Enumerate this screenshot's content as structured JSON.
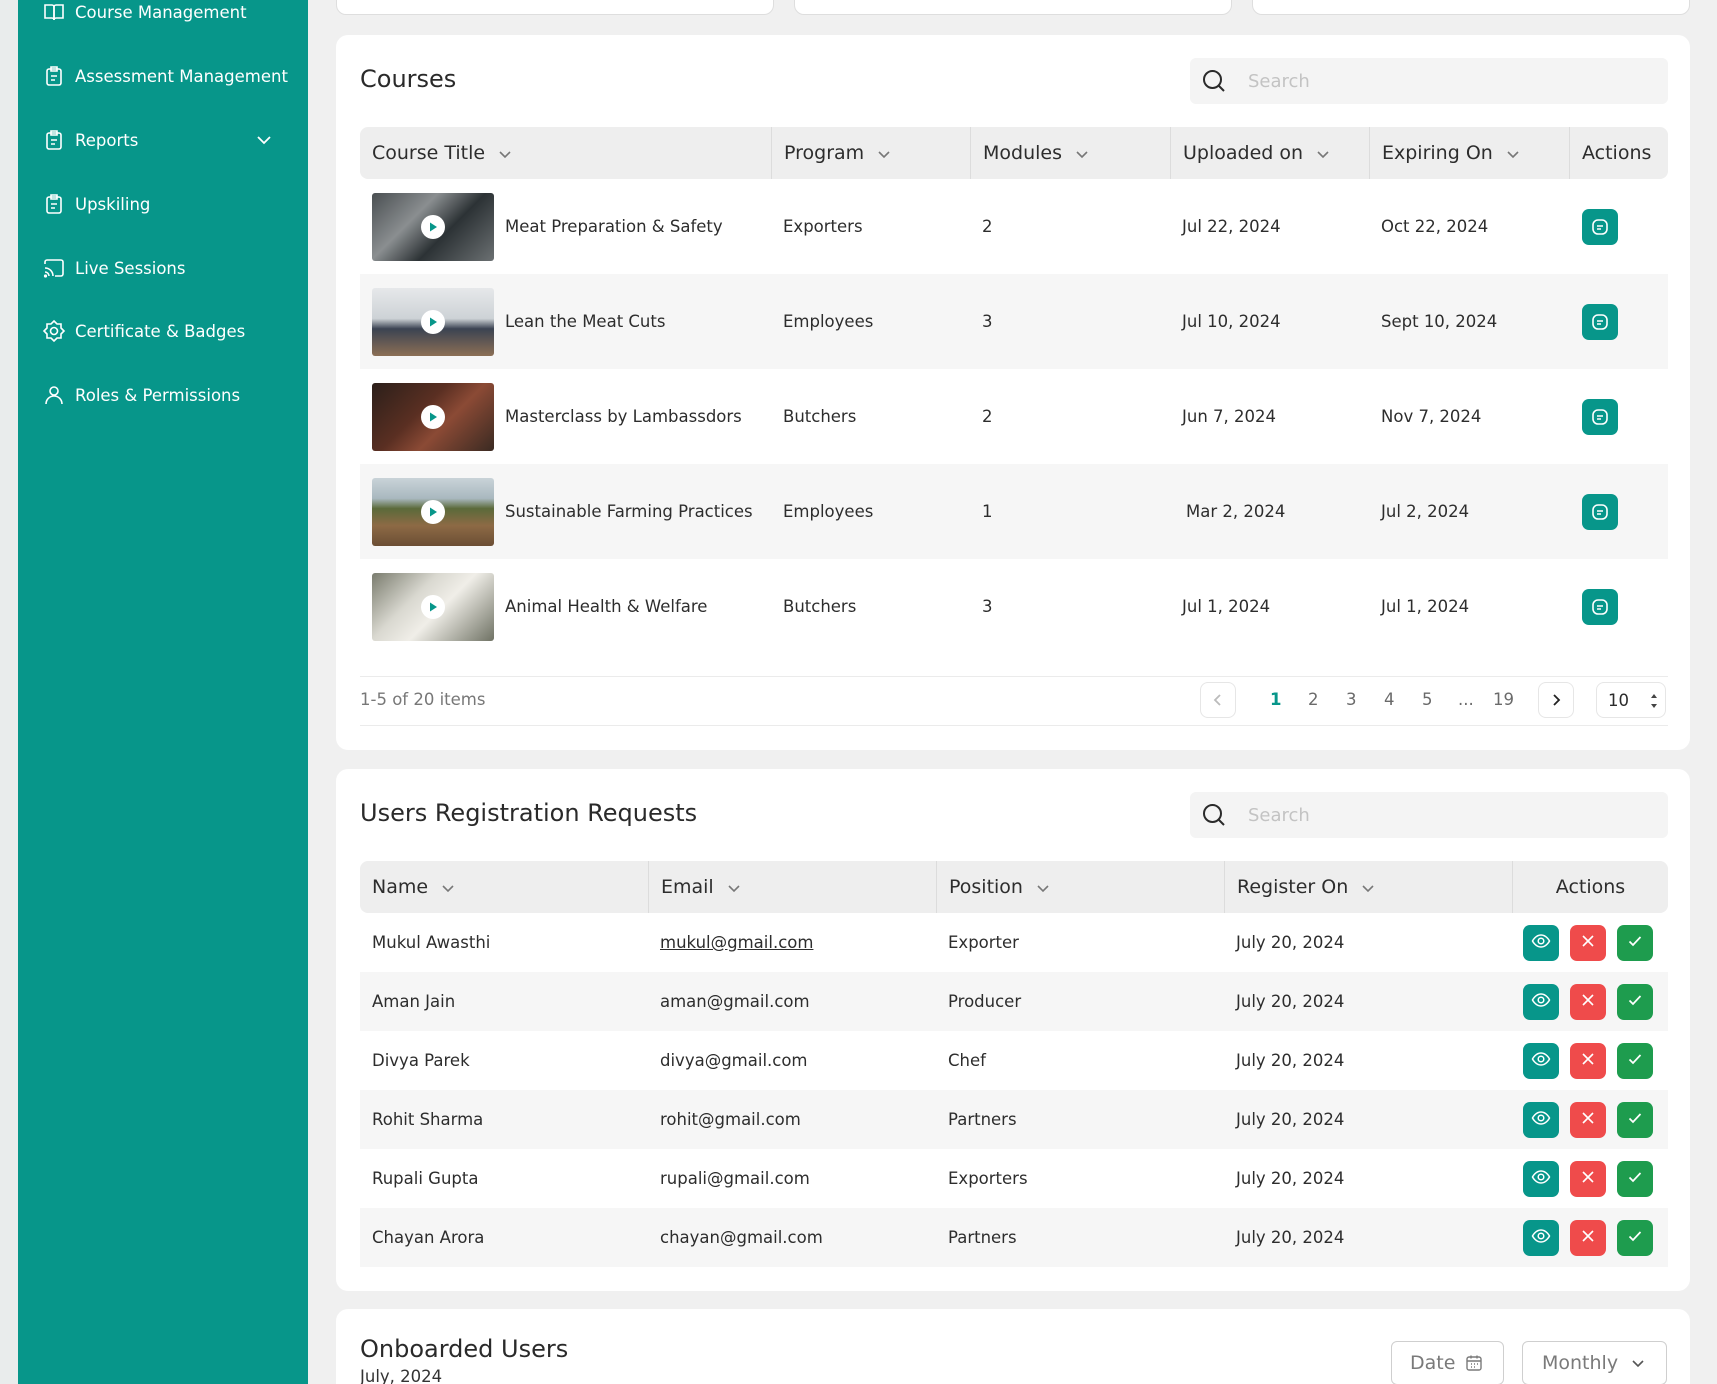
{
  "sidebar": {
    "items": [
      {
        "label": "Course Management",
        "icon": "book-icon"
      },
      {
        "label": "Assessment Management",
        "icon": "clipboard-icon"
      },
      {
        "label": "Reports",
        "icon": "clipboard-icon",
        "expandable": true
      },
      {
        "label": "Upskiling",
        "icon": "clipboard-icon"
      },
      {
        "label": "Live Sessions",
        "icon": "cast-icon"
      },
      {
        "label": "Certificate & Badges",
        "icon": "badge-icon"
      },
      {
        "label": "Roles & Permissions",
        "icon": "user-icon"
      }
    ]
  },
  "courses": {
    "title": "Courses",
    "search_placeholder": "Search",
    "columns": [
      "Course Title",
      "Program",
      "Modules",
      "Uploaded on",
      "Expiring On",
      "Actions"
    ],
    "rows": [
      {
        "title": "Meat Preparation & Safety",
        "program": "Exporters",
        "modules": "2",
        "uploaded": "Jul 22, 2024",
        "expiring": "Oct 22, 2024"
      },
      {
        "title": "Lean the Meat Cuts",
        "program": "Employees",
        "modules": "3",
        "uploaded": "Jul 10, 2024",
        "expiring": "Sept 10, 2024"
      },
      {
        "title": "Masterclass by Lambassdors",
        "program": "Butchers",
        "modules": "2",
        "uploaded": "Jun 7, 2024",
        "expiring": "Nov 7, 2024"
      },
      {
        "title": "Sustainable Farming Practices",
        "program": "Employees",
        "modules": "1",
        "uploaded": "Mar 2, 2024",
        "expiring": "Jul 2, 2024"
      },
      {
        "title": "Animal Health & Welfare",
        "program": "Butchers",
        "modules": "3",
        "uploaded": "Jul 1, 2024",
        "expiring": "Jul 1, 2024"
      }
    ],
    "pagination": {
      "summary": "1-5 of 20 items",
      "pages": [
        "1",
        "2",
        "3",
        "4",
        "5",
        "...",
        "19"
      ],
      "active_page": "1",
      "page_size": "10"
    }
  },
  "registrations": {
    "title": "Users Registration Requests",
    "search_placeholder": "Search",
    "columns": [
      "Name",
      "Email",
      "Position",
      "Register On",
      "Actions"
    ],
    "rows": [
      {
        "name": "Mukul Awasthi",
        "email": "mukul@gmail.com",
        "position": "Exporter",
        "registered": "July 20, 2024"
      },
      {
        "name": "Aman Jain",
        "email": "aman@gmail.com",
        "position": "Producer",
        "registered": "July 20, 2024"
      },
      {
        "name": "Divya Parek",
        "email": "divya@gmail.com",
        "position": "Chef",
        "registered": "July 20, 2024"
      },
      {
        "name": "Rohit Sharma",
        "email": "rohit@gmail.com",
        "position": "Partners",
        "registered": "July 20, 2024"
      },
      {
        "name": "Rupali Gupta",
        "email": "rupali@gmail.com",
        "position": "Exporters",
        "registered": "July 20, 2024"
      },
      {
        "name": "Chayan Arora",
        "email": "chayan@gmail.com",
        "position": "Partners",
        "registered": "July 20, 2024"
      }
    ]
  },
  "onboarded": {
    "title": "Onboarded Users",
    "subtitle": "July, 2024",
    "date_button": "Date",
    "period_select": "Monthly"
  },
  "colors": {
    "sidebar": "#07968a",
    "accent": "#07968a",
    "reject": "#ef4b4b",
    "approve": "#1e9c4e"
  }
}
